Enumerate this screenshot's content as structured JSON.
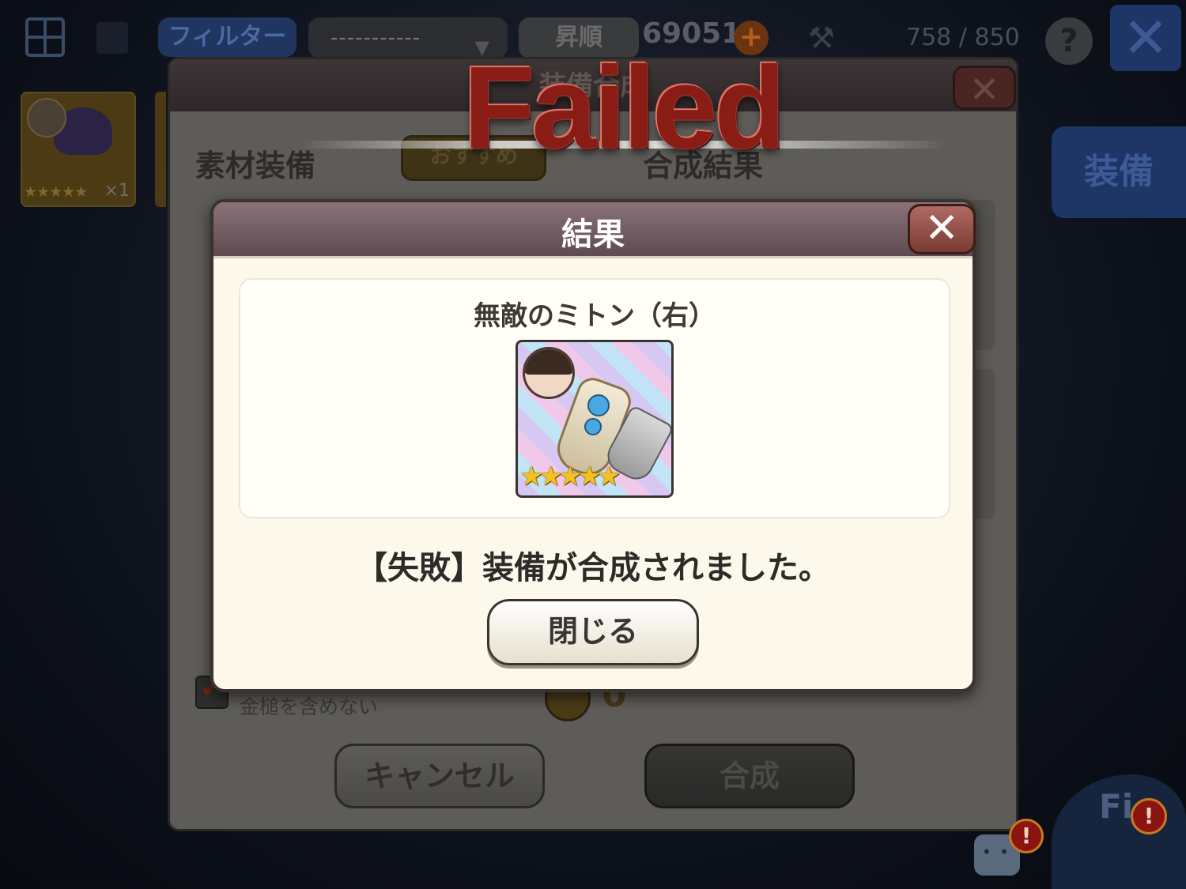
{
  "topbar": {
    "filter_label": "フィルター",
    "dropdown_value": "-----------",
    "sort_label": "昇順",
    "gold_count": "69051",
    "plus_symbol": "+",
    "capacity": "758 / 850",
    "help_symbol": "?",
    "close_symbol": "✕",
    "hammer_icon": "hammer-icon"
  },
  "inventory": {
    "item_stars": "★★★★★",
    "item_qty": "×1"
  },
  "side": {
    "equip_label": "装備"
  },
  "synthesis_dialog": {
    "title": "装備合成",
    "close_symbol": "✕",
    "material_label": "素材装備",
    "recommend_label": "おすすめ",
    "result_label": "合成結果",
    "exclude_label": "金槌を含めない",
    "coin_value": "0",
    "cancel_label": "キャンセル",
    "synthesize_label": "合成"
  },
  "banner": {
    "text": "Failed"
  },
  "result_dialog": {
    "title": "結果",
    "close_symbol": "✕",
    "item_name": "無敵のミトン（右）",
    "item_stars": "★★★★★",
    "message": "【失敗】装備が合成されました。",
    "close_label": "閉じる"
  },
  "mascot": {
    "text": "Fi",
    "alert_symbol": "!"
  }
}
